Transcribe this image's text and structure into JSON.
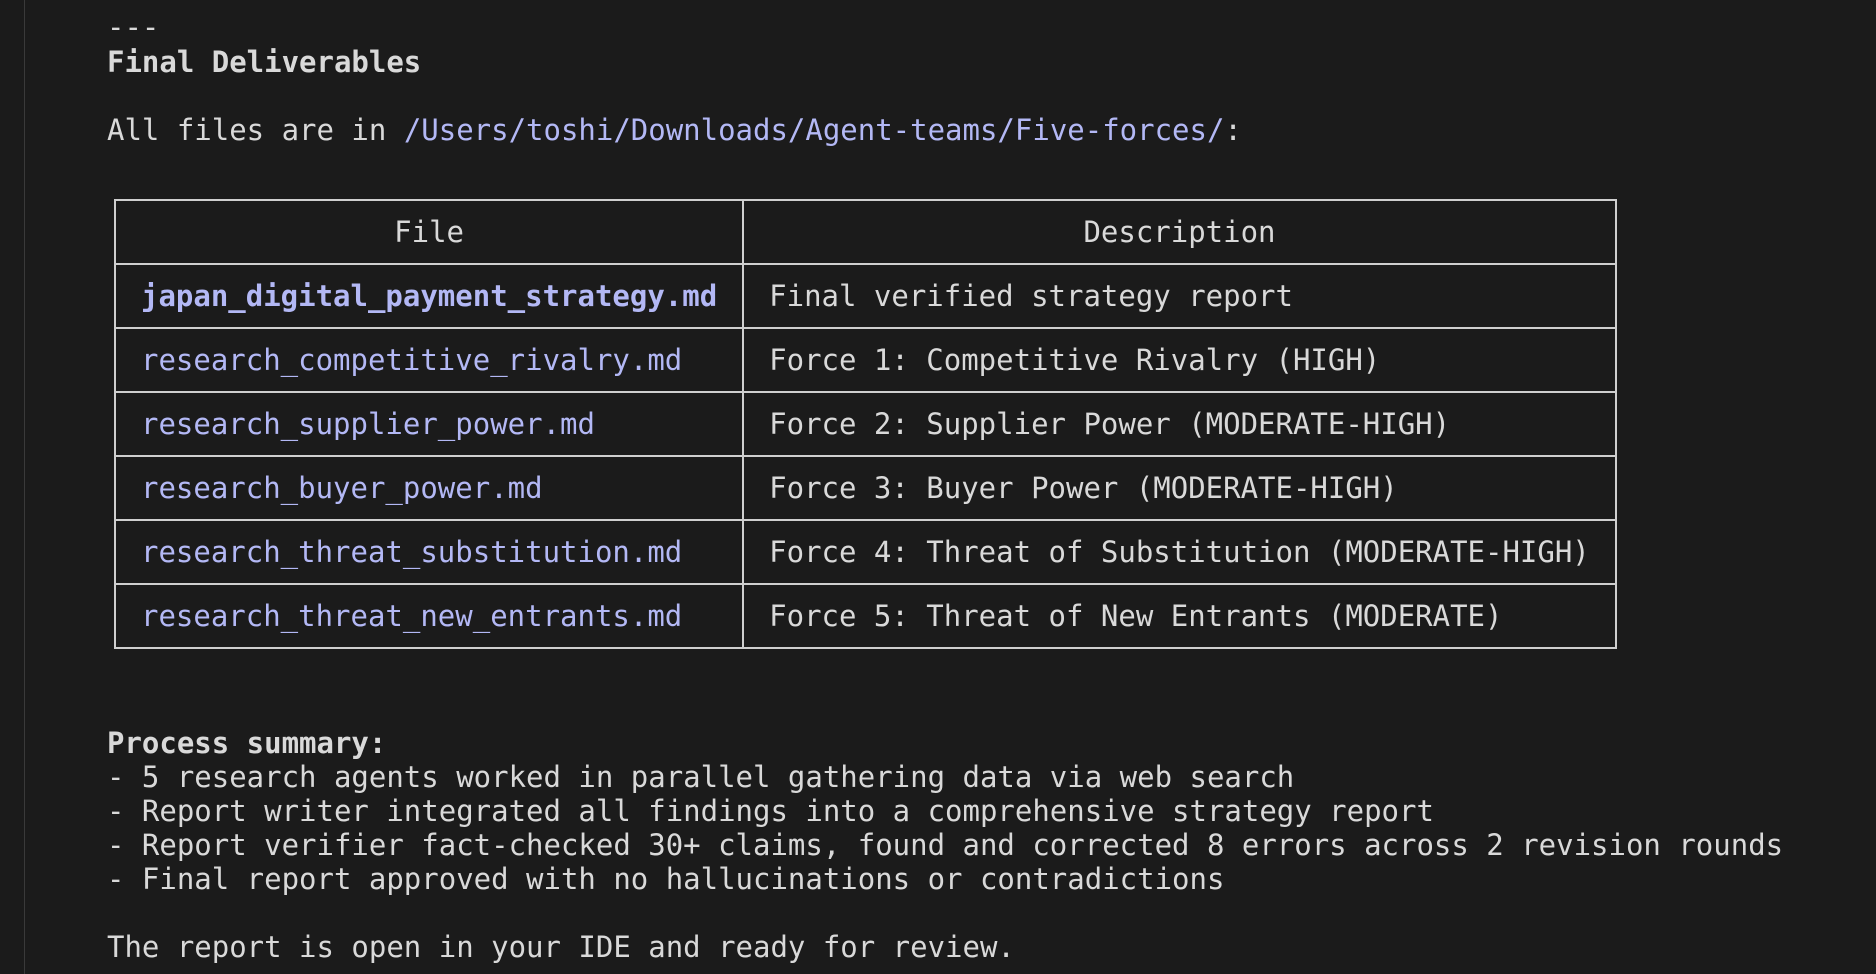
{
  "separator": "---",
  "title": "Final Deliverables",
  "intro": {
    "prefix": "All files are in ",
    "path": "/Users/toshi/Downloads/Agent-teams/Five-forces/",
    "suffix": ":"
  },
  "table": {
    "headers": [
      "File",
      "Description"
    ],
    "rows": [
      {
        "file": "japan_digital_payment_strategy.md",
        "description": "Final verified strategy report"
      },
      {
        "file": "research_competitive_rivalry.md",
        "description": "Force 1: Competitive Rivalry (HIGH)"
      },
      {
        "file": "research_supplier_power.md",
        "description": "Force 2: Supplier Power (MODERATE-HIGH)"
      },
      {
        "file": "research_buyer_power.md",
        "description": "Force 3: Buyer Power (MODERATE-HIGH)"
      },
      {
        "file": "research_threat_substitution.md",
        "description": "Force 4: Threat of Substitution (MODERATE-HIGH)"
      },
      {
        "file": "research_threat_new_entrants.md",
        "description": "Force 5: Threat of New Entrants (MODERATE)"
      }
    ]
  },
  "summary": {
    "heading": "Process summary:",
    "items": [
      "- 5 research agents worked in parallel gathering data via web search",
      "- Report writer integrated all findings into a comprehensive strategy report",
      "- Report verifier fact-checked 30+ claims, found and corrected 8 errors across 2 revision rounds",
      "- Final report approved with no hallucinations or contradictions"
    ]
  },
  "closing": "The report is open in your IDE and ready for review.",
  "colors": {
    "background": "#1b1b1b",
    "text": "#d9d9d9",
    "path": "#b3b8f5",
    "border": "#cfcfcf"
  }
}
